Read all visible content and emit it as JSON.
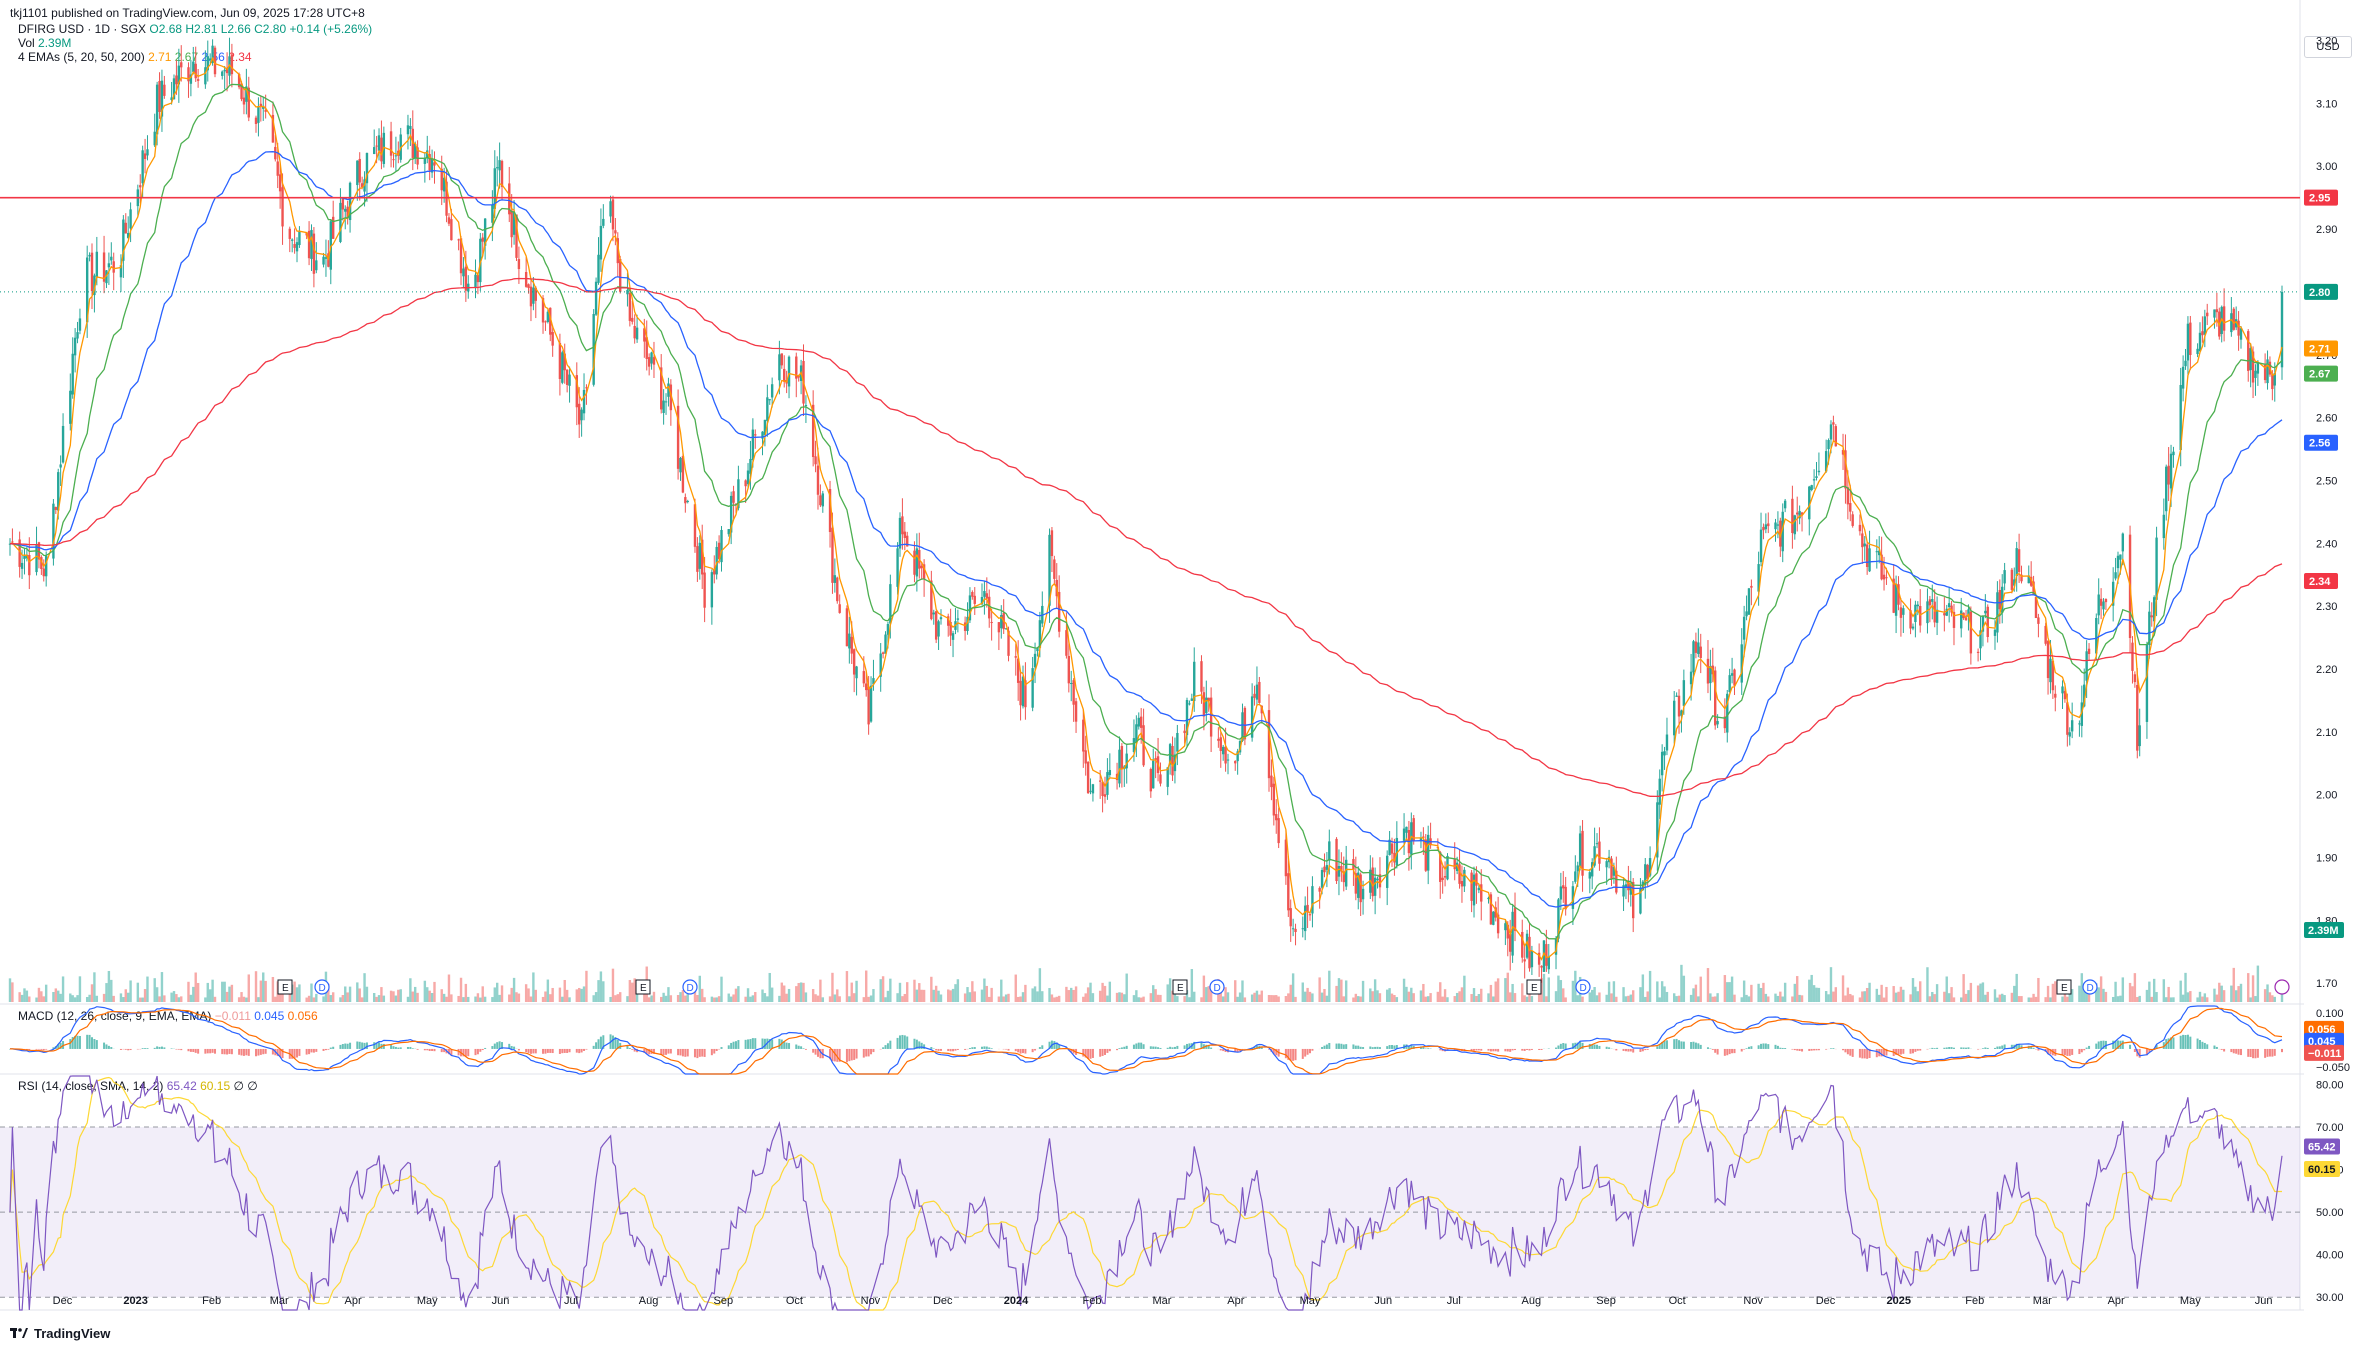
{
  "published": "tkj1101 published on TradingView.com, Jun 09, 2025 17:28 UTC+8",
  "symbol_line": {
    "symbol": "DFIRG USD · 1D · SGX",
    "ohlc": "O2.68 H2.81 L2.66 C2.80 +0.14 (+5.26%)"
  },
  "vol_line": {
    "label": "Vol",
    "value": "2.39M"
  },
  "ema_line": {
    "label": "4 EMAs (5, 20, 50, 200)",
    "values": [
      "2.71",
      "2.67",
      "2.56",
      "2.34"
    ]
  },
  "macd_line": {
    "label": "MACD (12, 26, close, 9, EMA, EMA)",
    "values": [
      "−0.011",
      "0.045",
      "0.056"
    ]
  },
  "rsi_line": {
    "label": "RSI (14, close, SMA, 14, 2)",
    "values": [
      "65.42",
      "60.15",
      "∅",
      "∅"
    ]
  },
  "currency": "USD",
  "brand": "TradingView",
  "colors": {
    "up": "#26a69a",
    "down": "#ef5350",
    "ema5": "#ff9800",
    "ema20": "#4caf50",
    "ema50": "#2962ff",
    "ema200": "#f23645",
    "resistance": "#f23645",
    "macd": "#2962ff",
    "signal": "#ff6d00",
    "rsi": "#7e57c2",
    "rsi_ma": "#fdd835",
    "rsi_band": "#7e57c2"
  },
  "chart_data": [
    {
      "type": "candlestick",
      "title": "DFIRG USD · 1D · SGX",
      "y_ticks": [
        "3.20",
        "3.10",
        "3.00",
        "2.90",
        "2.80",
        "2.70",
        "2.60",
        "2.50",
        "2.40",
        "2.30",
        "2.20",
        "2.10",
        "2.00",
        "1.90",
        "1.80",
        "1.70"
      ],
      "ylim": [
        1.67,
        3.22
      ],
      "x_ticks": [
        "Dec",
        "2023",
        "Feb",
        "Mar",
        "Apr",
        "May",
        "Jun",
        "Jul",
        "Aug",
        "Sep",
        "Oct",
        "Nov",
        "Dec",
        "2024",
        "Feb",
        "Mar",
        "Apr",
        "May",
        "Jun",
        "Jul",
        "Aug",
        "Sep",
        "Oct",
        "Nov",
        "Dec",
        "2025",
        "Feb",
        "Mar",
        "Apr",
        "May",
        "Jun"
      ],
      "series": [
        {
          "name": "Price",
          "points": [
            [
              "2022-11-10",
              2.4
            ],
            [
              "2022-11-25",
              2.36
            ],
            [
              "2022-12-10",
              2.82
            ],
            [
              "2022-12-25",
              2.85
            ],
            [
              "2023-01-10",
              3.1
            ],
            [
              "2023-01-25",
              3.17
            ],
            [
              "2023-02-10",
              3.15
            ],
            [
              "2023-02-25",
              3.05
            ],
            [
              "2023-03-05",
              2.9
            ],
            [
              "2023-03-20",
              2.85
            ],
            [
              "2023-04-05",
              3.0
            ],
            [
              "2023-04-20",
              3.05
            ],
            [
              "2023-05-05",
              3.02
            ],
            [
              "2023-05-20",
              2.8
            ],
            [
              "2023-06-01",
              3.0
            ],
            [
              "2023-06-10",
              2.85
            ],
            [
              "2023-06-25",
              2.7
            ],
            [
              "2023-07-05",
              2.58
            ],
            [
              "2023-07-15",
              2.95
            ],
            [
              "2023-07-25",
              2.75
            ],
            [
              "2023-08-10",
              2.62
            ],
            [
              "2023-08-25",
              2.33
            ],
            [
              "2023-09-10",
              2.5
            ],
            [
              "2023-09-25",
              2.7
            ],
            [
              "2023-10-05",
              2.65
            ],
            [
              "2023-10-20",
              2.3
            ],
            [
              "2023-11-01",
              2.12
            ],
            [
              "2023-11-15",
              2.43
            ],
            [
              "2023-12-01",
              2.25
            ],
            [
              "2023-12-20",
              2.32
            ],
            [
              "2024-01-05",
              2.15
            ],
            [
              "2024-01-15",
              2.38
            ],
            [
              "2024-02-01",
              2.0
            ],
            [
              "2024-02-20",
              2.1
            ],
            [
              "2024-03-01",
              2.0
            ],
            [
              "2024-03-15",
              2.18
            ],
            [
              "2024-04-01",
              2.05
            ],
            [
              "2024-04-10",
              2.2
            ],
            [
              "2024-04-25",
              1.76
            ],
            [
              "2024-05-10",
              1.9
            ],
            [
              "2024-05-25",
              1.85
            ],
            [
              "2024-06-10",
              1.95
            ],
            [
              "2024-06-25",
              1.88
            ],
            [
              "2024-07-10",
              1.85
            ],
            [
              "2024-07-25",
              1.78
            ],
            [
              "2024-08-05",
              1.72
            ],
            [
              "2024-08-20",
              1.9
            ],
            [
              "2024-09-01",
              1.92
            ],
            [
              "2024-09-15",
              1.8
            ],
            [
              "2024-09-25",
              2.05
            ],
            [
              "2024-10-10",
              2.25
            ],
            [
              "2024-10-20",
              2.1
            ],
            [
              "2024-11-05",
              2.4
            ],
            [
              "2024-11-20",
              2.45
            ],
            [
              "2024-12-05",
              2.6
            ],
            [
              "2024-12-15",
              2.42
            ],
            [
              "2025-01-01",
              2.3
            ],
            [
              "2025-01-20",
              2.28
            ],
            [
              "2025-02-05",
              2.25
            ],
            [
              "2025-02-20",
              2.38
            ],
            [
              "2025-03-05",
              2.2
            ],
            [
              "2025-03-15",
              2.1
            ],
            [
              "2025-03-25",
              2.3
            ],
            [
              "2025-04-05",
              2.42
            ],
            [
              "2025-04-10",
              2.08
            ],
            [
              "2025-04-20",
              2.45
            ],
            [
              "2025-05-01",
              2.72
            ],
            [
              "2025-05-15",
              2.76
            ],
            [
              "2025-05-25",
              2.7
            ],
            [
              "2025-06-05",
              2.66
            ],
            [
              "2025-06-09",
              2.8
            ]
          ]
        },
        {
          "name": "EMA 5",
          "last": 2.71
        },
        {
          "name": "EMA 20",
          "last": 2.67
        },
        {
          "name": "EMA 50",
          "last": 2.56
        },
        {
          "name": "EMA 200",
          "last": 2.34
        }
      ],
      "horizontal_line": {
        "value": 2.95,
        "label": "2.95"
      },
      "price_labels": [
        "2.95",
        "2.80",
        "2.71",
        "2.67",
        "2.56",
        "2.34"
      ],
      "volume_label": "2.39M",
      "event_markers": [
        [
          "E",
          "D"
        ],
        [
          "E",
          "D"
        ],
        [
          "E",
          "D"
        ],
        [
          "E",
          "D"
        ],
        [
          "E",
          "D"
        ]
      ]
    },
    {
      "type": "line",
      "title": "MACD (12, 26, close, 9, EMA, EMA)",
      "y_ticks": [
        "0.100",
        "0.050",
        "0.000",
        "−0.050"
      ],
      "ylim": [
        -0.07,
        0.12
      ],
      "series": [
        {
          "name": "MACD",
          "last": 0.045
        },
        {
          "name": "Signal",
          "last": 0.056
        },
        {
          "name": "Histogram",
          "last": -0.011
        }
      ],
      "price_labels": [
        "0.056",
        "0.045",
        "−0.011"
      ]
    },
    {
      "type": "line",
      "title": "RSI (14, close, SMA, 14, 2)",
      "y_ticks": [
        "80.00",
        "70.00",
        "60.00",
        "50.00",
        "40.00",
        "30.00"
      ],
      "ylim": [
        27,
        82
      ],
      "bands": [
        30,
        50,
        70
      ],
      "series": [
        {
          "name": "RSI",
          "last": 65.42
        },
        {
          "name": "RSI-based MA",
          "last": 60.15
        }
      ],
      "price_labels": [
        "65.42",
        "60.15"
      ]
    }
  ]
}
